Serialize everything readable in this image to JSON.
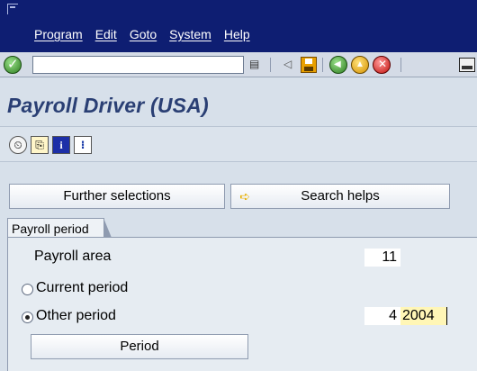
{
  "menu": {
    "items": [
      "Program",
      "Edit",
      "Goto",
      "System",
      "Help"
    ]
  },
  "toolbar": {
    "command_value": "",
    "icons": [
      "ok-icon",
      "dropdown-icon",
      "back-arrow-icon",
      "save-icon",
      "back-icon",
      "exit-icon",
      "cancel-icon",
      "print-icon"
    ]
  },
  "page": {
    "title": "Payroll Driver (USA)"
  },
  "app_toolbar": {
    "icons": [
      "execute-clock-icon",
      "get-variant-icon",
      "info-icon",
      "selection-options-icon"
    ],
    "info_glyph": "i"
  },
  "buttons": {
    "further_selections": "Further selections",
    "search_helps": "Search helps",
    "period": "Period"
  },
  "payroll_period": {
    "group_label": "Payroll period",
    "area_label": "Payroll area",
    "area_value": "11",
    "current_period_label": "Current period",
    "other_period_label": "Other period",
    "selected": "other",
    "period_value": "4",
    "year_value": "2004"
  },
  "colors": {
    "menubar": "#0e1e72",
    "title_text": "#2a3f74",
    "year_highlight": "#fff6b6",
    "background": "#d7e0ea"
  }
}
